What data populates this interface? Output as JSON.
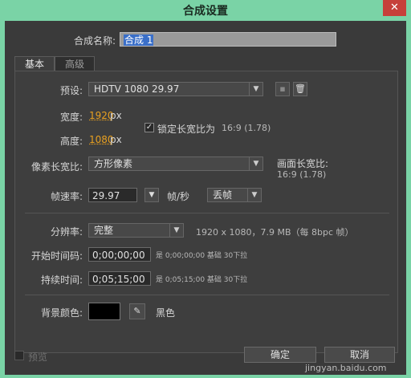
{
  "window": {
    "title": "合成设置",
    "close_glyph": "✕"
  },
  "comp_name": {
    "label": "合成名称:",
    "value": "合成 1"
  },
  "tabs": [
    {
      "label": "基本"
    },
    {
      "label": "高级"
    }
  ],
  "preset": {
    "label": "预设:",
    "value": "HDTV 1080 29.97"
  },
  "width": {
    "label": "宽度:",
    "value": "1920",
    "unit": "px"
  },
  "height": {
    "label": "高度:",
    "value": "1080",
    "unit": "px"
  },
  "lock_aspect": {
    "checked": true,
    "label": "锁定长宽比为",
    "ratio": "16:9 (1.78)"
  },
  "pixel_aspect": {
    "label": "像素长宽比:",
    "value": "方形像素"
  },
  "frame_aspect": {
    "label": "画面长宽比:",
    "value": "16:9 (1.78)"
  },
  "frame_rate": {
    "label": "帧速率:",
    "value": "29.97",
    "unit": "帧/秒",
    "drop_value": "丢帧"
  },
  "resolution": {
    "label": "分辨率:",
    "value": "完整",
    "info": "1920 x 1080，7.9 MB（每 8bpc 帧）"
  },
  "start_timecode": {
    "label": "开始时间码:",
    "value": "0;00;00;00",
    "info": "是 0;00;00;00  基础 30下拉"
  },
  "duration": {
    "label": "持续时间:",
    "value": "0;05;15;00",
    "info": "是 0;05;15;00  基础 30下拉"
  },
  "background": {
    "label": "背景颜色:",
    "color": "#000000",
    "name": "黑色"
  },
  "footer": {
    "preview_label": "预览",
    "ok_label": "确定",
    "cancel_label": "取消"
  },
  "watermark": {
    "text": "jingyan.baidu.com"
  }
}
